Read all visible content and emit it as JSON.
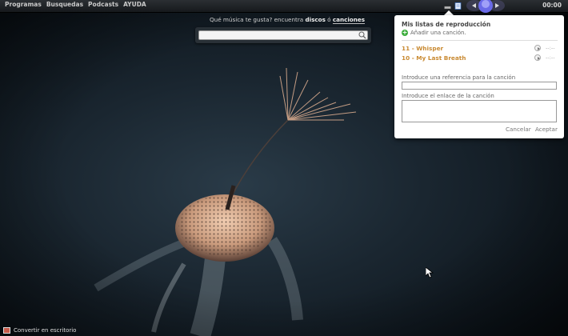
{
  "menu": [
    "Programas",
    "Busquedas",
    "Podcasts",
    "AYUDA"
  ],
  "clock": "00:00",
  "search": {
    "caption_pre": "Qué música te gusta? encuentra ",
    "caption_discos": "discos",
    "caption_mid": " ó ",
    "caption_canciones": "canciones",
    "placeholder": ""
  },
  "panel": {
    "title": "Mis listas de reproducción",
    "add_label": "Añadir una canción.",
    "tracks": [
      {
        "name": "11 - Whisper",
        "duration": "--:--"
      },
      {
        "name": "10 - My Last Breath",
        "duration": "--:--"
      }
    ],
    "ref_label": "Introduce una referencia para la canción",
    "link_label": "Introduce el enlace de la canción",
    "cancel": "Cancelar",
    "accept": "Aceptar"
  },
  "bottom": {
    "label": "Convertir en escritorio"
  },
  "colors": {
    "accent_track": "#c98a32",
    "add_green": "#3cad3c"
  }
}
